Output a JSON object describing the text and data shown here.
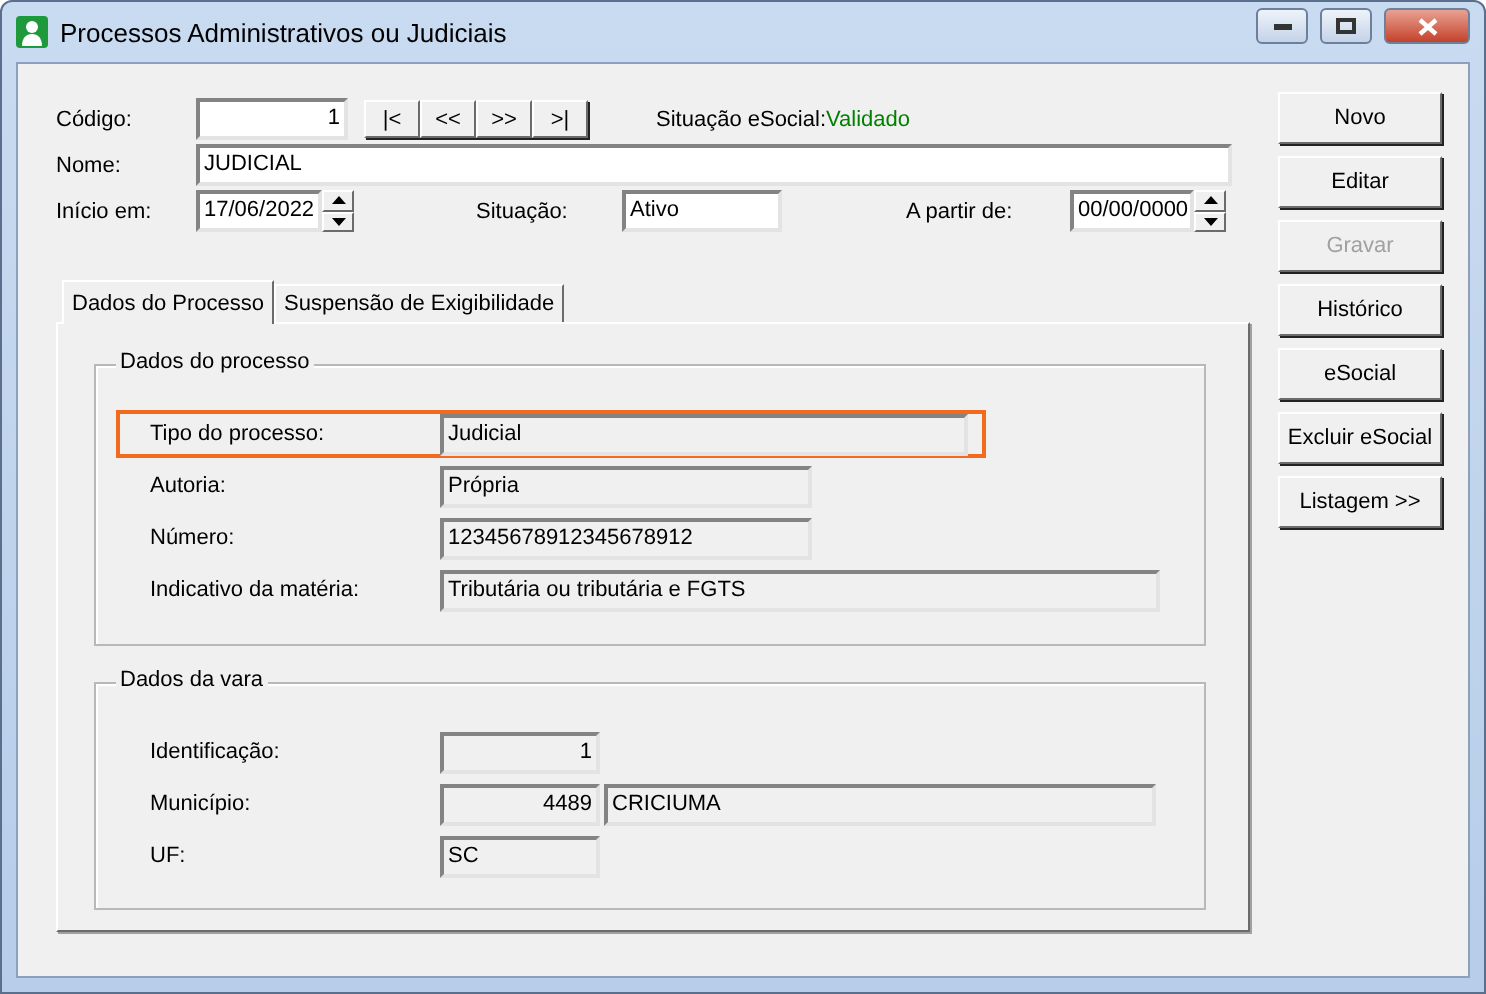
{
  "window": {
    "title": "Processos Administrativos ou Judiciais"
  },
  "codigo": {
    "label": "Código:",
    "value": "1"
  },
  "nav_buttons": [
    "|<",
    "<<",
    ">>",
    ">|"
  ],
  "esocial_status": {
    "label": "Situação eSocial:",
    "value": "Validado",
    "color": "#008000"
  },
  "nome": {
    "label": "Nome:",
    "value": "JUDICIAL"
  },
  "inicio": {
    "label": "Início em:",
    "value": "17/06/2022"
  },
  "situacao": {
    "label": "Situação:",
    "value": "Ativo"
  },
  "a_partir": {
    "label": "A partir de:",
    "value": "00/00/0000"
  },
  "tabs": [
    {
      "label": "Dados do Processo",
      "selected": true
    },
    {
      "label": "Suspensão de Exigibilidade",
      "selected": false
    }
  ],
  "groups": [
    {
      "title": "Dados do processo",
      "rows": [
        {
          "label": "Tipo do processo:",
          "values": [
            "Judicial"
          ],
          "highlighted": true
        },
        {
          "label": "Autoria:",
          "values": [
            "Própria"
          ],
          "highlighted": false
        },
        {
          "label": "Número:",
          "values": [
            "12345678912345678912"
          ],
          "highlighted": false
        },
        {
          "label": "Indicativo da matéria:",
          "values": [
            "Tributária ou tributária e FGTS"
          ],
          "highlighted": false
        }
      ]
    },
    {
      "title": "Dados da vara",
      "rows": [
        {
          "label": "Identificação:",
          "values": [
            "1"
          ],
          "highlighted": false
        },
        {
          "label": "Município:",
          "values": [
            "4489",
            "CRICIUMA"
          ],
          "highlighted": false
        },
        {
          "label": "UF:",
          "values": [
            "SC"
          ],
          "highlighted": false
        }
      ]
    }
  ],
  "buttons": [
    {
      "label": "Novo",
      "disabled": false
    },
    {
      "label": "Editar",
      "disabled": false
    },
    {
      "label": "Gravar",
      "disabled": true
    },
    {
      "label": "Histórico",
      "disabled": false
    },
    {
      "label": "eSocial",
      "disabled": false
    },
    {
      "label": "Excluir eSocial",
      "disabled": false
    },
    {
      "label": "Listagem >>",
      "disabled": false
    }
  ]
}
